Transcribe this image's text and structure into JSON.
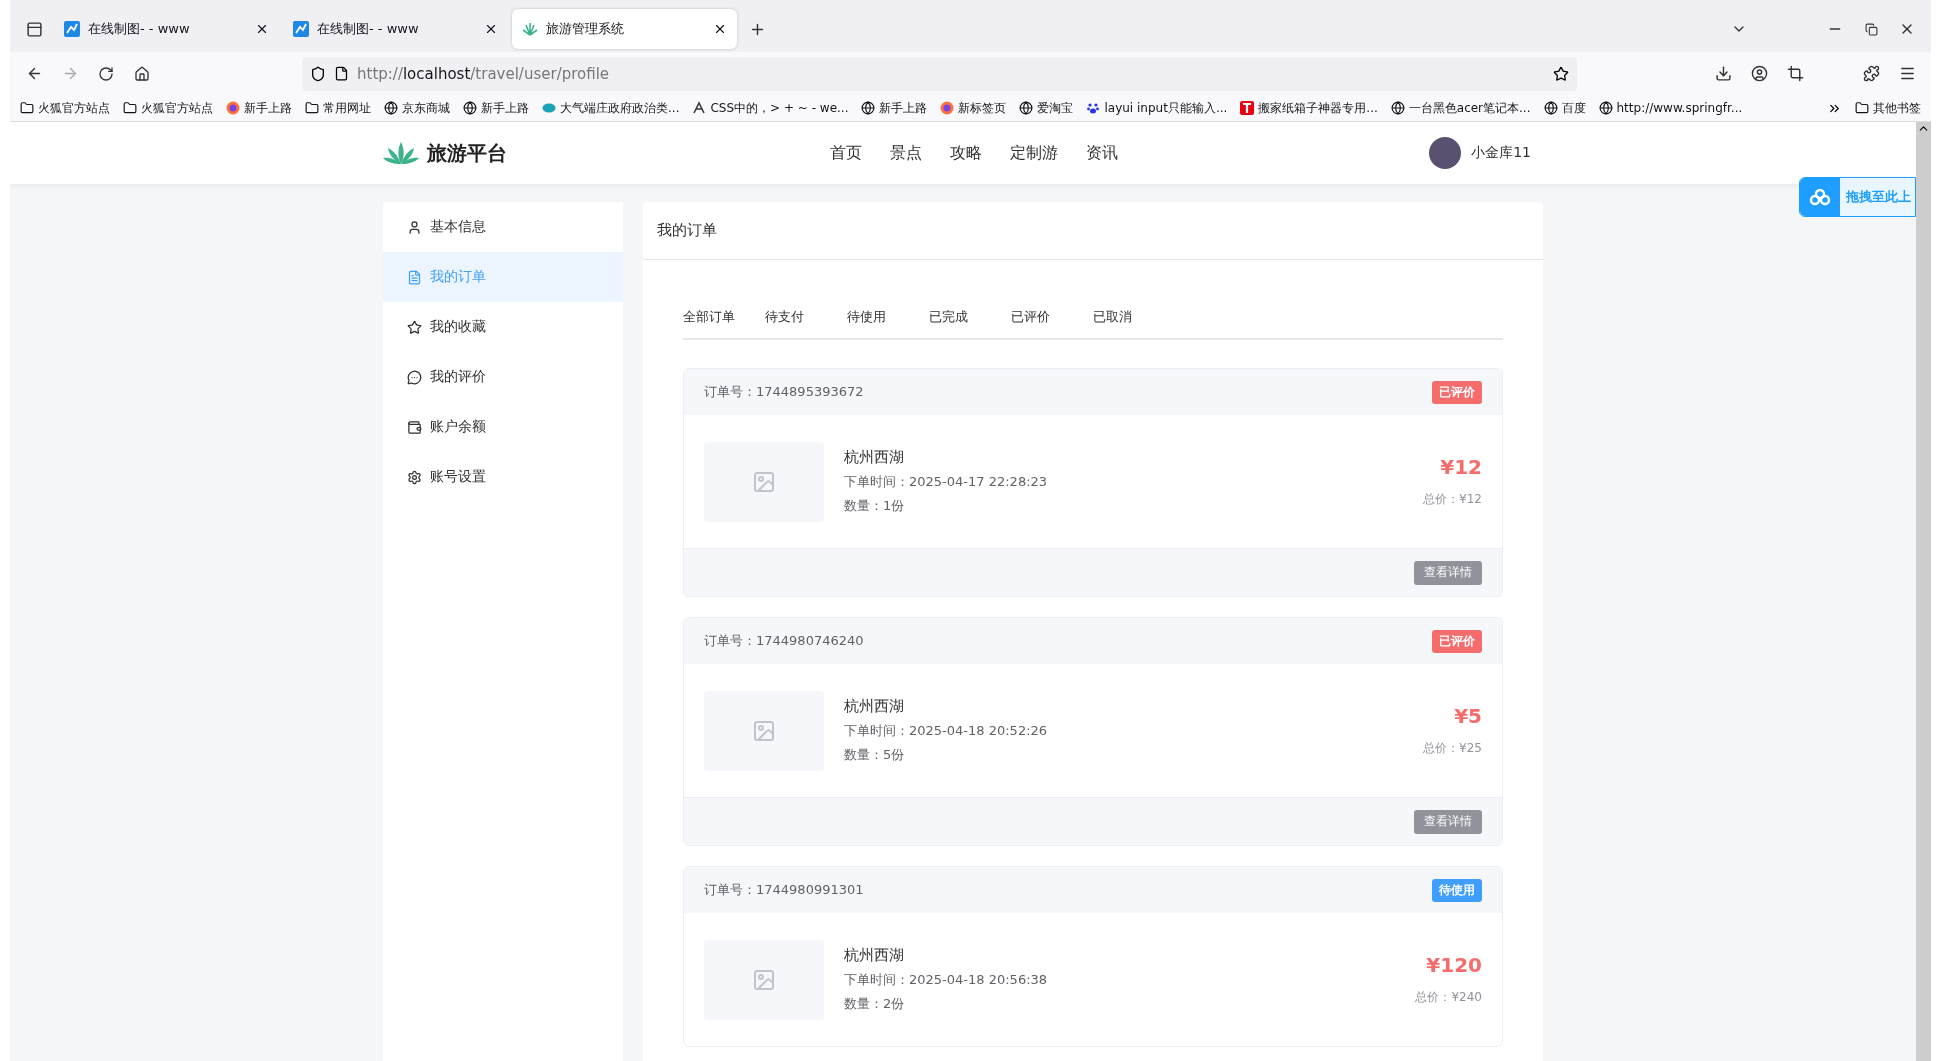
{
  "browser": {
    "tabs": [
      {
        "title": "在线制图- - www",
        "kind": "chart",
        "selected": false
      },
      {
        "title": "在线制图- - www",
        "kind": "chart",
        "selected": false
      },
      {
        "title": "旅游管理系统",
        "kind": "leaf",
        "selected": true
      }
    ],
    "url": {
      "scheme": "http://",
      "host": "localhost",
      "path": "/travel/user/profile"
    },
    "bookmarks": [
      {
        "label": "火狐官方站点",
        "kind": "folder"
      },
      {
        "label": "火狐官方站点",
        "kind": "folder"
      },
      {
        "label": "新手上路",
        "kind": "fox"
      },
      {
        "label": "常用网址",
        "kind": "folder"
      },
      {
        "label": "京东商城",
        "kind": "globe"
      },
      {
        "label": "新手上路",
        "kind": "globe"
      },
      {
        "label": "大气端庄政府政治类...",
        "kind": "site"
      },
      {
        "label": "CSS中的，> + ~ - we...",
        "kind": "ant"
      },
      {
        "label": "新手上路",
        "kind": "globe"
      },
      {
        "label": "新标签页",
        "kind": "fox"
      },
      {
        "label": "爱淘宝",
        "kind": "globe"
      },
      {
        "label": "layui input只能输入...",
        "kind": "paw"
      },
      {
        "label": "搬家纸箱子神器专用...",
        "kind": "letter"
      },
      {
        "label": "一台黑色acer笔记本...",
        "kind": "globe"
      },
      {
        "label": "百度",
        "kind": "globe"
      },
      {
        "label": "http://www.springfr...",
        "kind": "globe"
      }
    ],
    "other_bookmarks": "其他书签"
  },
  "site": {
    "logo": "旅游平台",
    "nav": [
      "首页",
      "景点",
      "攻略",
      "定制游",
      "资讯"
    ],
    "user": "小金库11"
  },
  "upload_widget": "拖拽至此上",
  "sidebar": [
    {
      "label": "基本信息",
      "selected": false
    },
    {
      "label": "我的订单",
      "selected": true
    },
    {
      "label": "我的收藏",
      "selected": false
    },
    {
      "label": "我的评价",
      "selected": false
    },
    {
      "label": "账户余额",
      "selected": false
    },
    {
      "label": "账号设置",
      "selected": false
    }
  ],
  "panel_title": "我的订单",
  "order_tabs": [
    "全部订单",
    "待支付",
    "待使用",
    "已完成",
    "已评价",
    "已取消"
  ],
  "orders": [
    {
      "order_no": "订单号：1744895393672",
      "status": "已评价",
      "color": "#f56c6c",
      "title": "杭州西湖",
      "time": "下单时间：2025-04-17 22:28:23",
      "qty": "数量：1份",
      "price": "¥12",
      "total": "总价：¥12",
      "action": "查看详情"
    },
    {
      "order_no": "订单号：1744980746240",
      "status": "已评价",
      "color": "#f56c6c",
      "title": "杭州西湖",
      "time": "下单时间：2025-04-18 20:52:26",
      "qty": "数量：5份",
      "price": "¥5",
      "total": "总价：¥25",
      "action": "查看详情"
    },
    {
      "order_no": "订单号：1744980991301",
      "status": "待使用",
      "color": "#409eff",
      "title": "杭州西湖",
      "time": "下单时间：2025-04-18 20:56:38",
      "qty": "数量：2份",
      "price": "¥120",
      "total": "总价：¥240"
    }
  ]
}
